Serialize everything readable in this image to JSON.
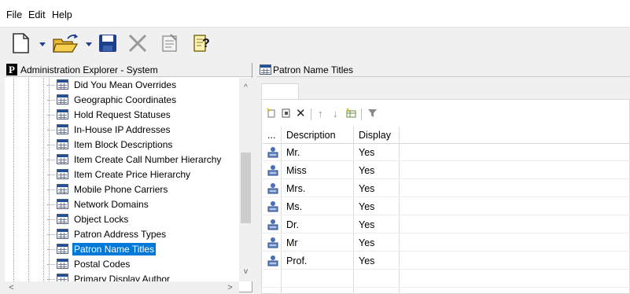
{
  "menu": {
    "file": "File",
    "edit": "Edit",
    "help": "Help"
  },
  "toolbar_icons": [
    "new-document-icon",
    "dropdown-arrow-icon",
    "open-folder-icon",
    "dropdown-arrow-icon",
    "save-icon",
    "delete-icon",
    "properties-icon",
    "help-icon"
  ],
  "left_panel": {
    "icon_letter": "P",
    "title": "Administration Explorer - System",
    "tree_items": [
      {
        "label": "Did You Mean Overrides"
      },
      {
        "label": "Geographic Coordinates"
      },
      {
        "label": "Hold Request Statuses"
      },
      {
        "label": "In-House IP Addresses"
      },
      {
        "label": "Item Block Descriptions"
      },
      {
        "label": "Item Create Call Number Hierarchy"
      },
      {
        "label": "Item Create Price Hierarchy"
      },
      {
        "label": "Mobile Phone Carriers"
      },
      {
        "label": "Network Domains"
      },
      {
        "label": "Object Locks"
      },
      {
        "label": "Patron Address Types"
      },
      {
        "label": "Patron Name Titles",
        "selected": true
      },
      {
        "label": "Postal Codes"
      },
      {
        "label": "Primary Display Author"
      }
    ],
    "scroll_up": "^",
    "scroll_down": "v",
    "scroll_left": "<",
    "scroll_right": ">"
  },
  "right_panel": {
    "title": "Patron Name Titles",
    "grid_toolbar_icons": [
      "new-row-icon",
      "copy-row-icon",
      "delete-icon",
      "move-up-icon",
      "move-down-icon",
      "table-view-icon",
      "filter-icon"
    ],
    "columns": [
      "...",
      "Description",
      "Display"
    ],
    "rows": [
      {
        "description": "Mr.",
        "display": "Yes"
      },
      {
        "description": "Miss",
        "display": "Yes"
      },
      {
        "description": "Mrs.",
        "display": "Yes"
      },
      {
        "description": "Ms.",
        "display": "Yes"
      },
      {
        "description": "Dr.",
        "display": "Yes"
      },
      {
        "description": "Mr",
        "display": "Yes"
      },
      {
        "description": "Prof.",
        "display": "Yes"
      }
    ]
  }
}
